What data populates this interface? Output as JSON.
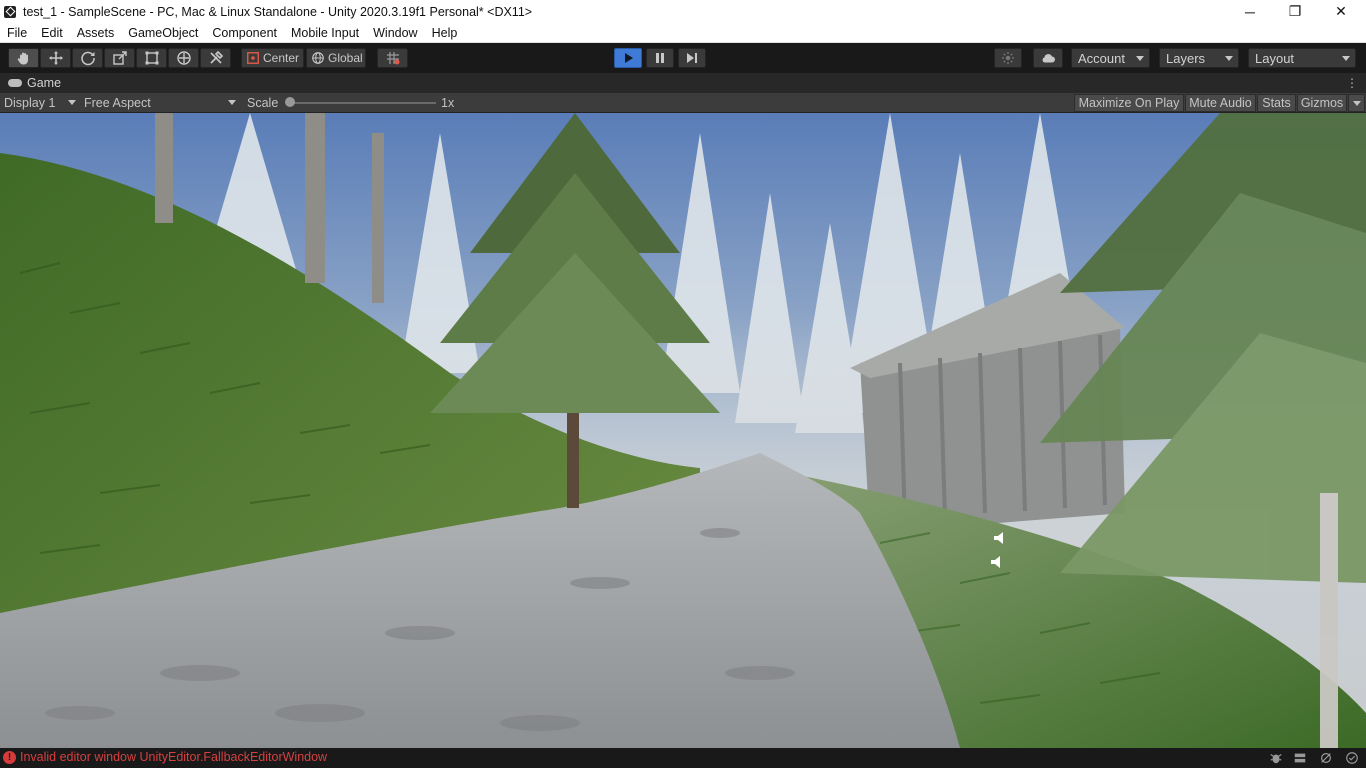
{
  "window": {
    "title": "test_1 - SampleScene - PC, Mac & Linux Standalone - Unity 2020.3.19f1 Personal* <DX11>",
    "controls": {
      "minimize": "─",
      "restore": "❐",
      "close": "✕"
    }
  },
  "menu": [
    "File",
    "Edit",
    "Assets",
    "GameObject",
    "Component",
    "Mobile Input",
    "Window",
    "Help"
  ],
  "toolbar": {
    "pivot_label": "Center",
    "space_label": "Global",
    "account_label": "Account",
    "layers_label": "Layers",
    "layout_label": "Layout",
    "tools": [
      "hand-tool-icon",
      "move-tool-icon",
      "rotate-tool-icon",
      "scale-tool-icon",
      "rect-tool-icon",
      "transform-tool-icon",
      "custom-tool-icon"
    ],
    "play_color": "#3e7ad6"
  },
  "game_tab": {
    "label": "Game",
    "display_label": "Display 1",
    "aspect_label": "Free Aspect",
    "scale_label": "Scale",
    "scale_value": "1x",
    "maximize_label": "Maximize On Play",
    "mute_label": "Mute Audio",
    "stats_label": "Stats",
    "gizmos_label": "Gizmos"
  },
  "status": {
    "error_message": "Invalid editor window UnityEditor.FallbackEditorWindow",
    "error_color": "#d64040"
  }
}
